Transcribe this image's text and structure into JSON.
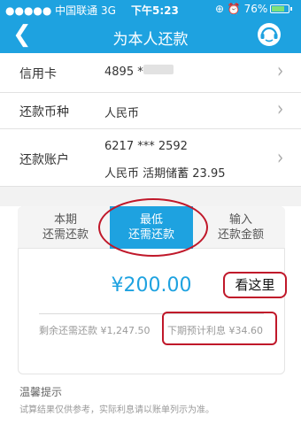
{
  "status": {
    "carrier": "●●●●● 中国联通  3G",
    "time": "下午5:23",
    "battery_label": "76%",
    "battery_level": 0.76
  },
  "nav": {
    "title": "为本人还款"
  },
  "rows": {
    "card": {
      "label": "信用卡",
      "value": "4895 ***"
    },
    "currency": {
      "label": "还款币种",
      "value": "人民币"
    },
    "account": {
      "label": "还款账户",
      "value": "6217 *** 2592",
      "detail": "人民币  活期储蓄  23.95"
    }
  },
  "tabs": [
    {
      "line1": "本期",
      "line2": "还需还款"
    },
    {
      "line1": "最低",
      "line2": "还需还款"
    },
    {
      "line1": "输入",
      "line2": "还款金额"
    }
  ],
  "amount": "¥200.00",
  "remaining": {
    "label": "剩余还需还款",
    "value": "¥1,247.50"
  },
  "interest": {
    "label": "下期预计利息",
    "value": "¥34.60"
  },
  "callout": "看这里",
  "tips": {
    "title": "温馨提示",
    "text": "试算结果仅供参考，实际利息请以账单列示为准。"
  },
  "colors": {
    "accent": "#1ea2e0",
    "annotation": "#c0182a"
  }
}
